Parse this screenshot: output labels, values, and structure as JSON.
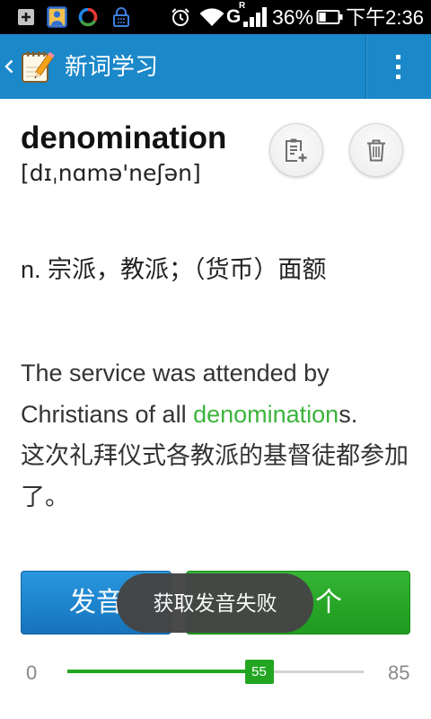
{
  "status_bar": {
    "network_type": "G",
    "roaming_indicator": "R",
    "battery_percent": "36%",
    "time": "下午2:36",
    "icons": [
      "add-box-icon",
      "contacts-photo-icon",
      "sync-icon",
      "lock-icon",
      "alarm-icon",
      "wifi-icon",
      "signal-icon",
      "battery-icon"
    ]
  },
  "app_bar": {
    "title": "新词学习",
    "icons": [
      "back-chevron-icon",
      "notebook-pencil-icon",
      "overflow-menu-icon"
    ]
  },
  "word": {
    "headword": "denomination",
    "phonetic": "[dɪˌnɑmə'neʃən]",
    "definition": "n. 宗派，教派；（货币）面额",
    "action_icons": [
      "add-to-notebook-icon",
      "trash-icon"
    ]
  },
  "example": {
    "en_before": "The service was attended by Christians of all ",
    "en_highlight": "denomination",
    "en_after": "s.",
    "zh": "这次礼拜仪式各教派的基督徒都参加了。"
  },
  "actions": {
    "pronounce_label": "发音",
    "next_label": "个"
  },
  "toast": {
    "message": "获取发音失败"
  },
  "slider": {
    "min": 0,
    "max": 85,
    "value": 55
  },
  "colors": {
    "status_bar": "#000000",
    "app_bar": "#1b88ca",
    "highlight_text": "#3cb43c",
    "pronounce_button": "#1d84cc",
    "next_button": "#27a527",
    "slider_fill": "#22a622",
    "toast_bg": "#454545"
  }
}
